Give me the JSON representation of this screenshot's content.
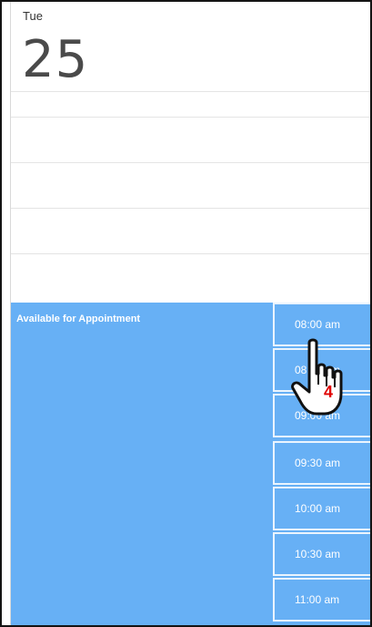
{
  "day": {
    "name": "Tue",
    "number": "25"
  },
  "appointment": {
    "label": "Available for Appointment",
    "color": "#67b0f5"
  },
  "time_slots": [
    "08:00 am",
    "08:30 am",
    "09:00 am",
    "09:30 am",
    "10:00 am",
    "10:30 am",
    "11:00 am"
  ],
  "cursor": {
    "icon": "hand-pointer-icon",
    "step_number": "4",
    "step_color": "#e00000"
  }
}
